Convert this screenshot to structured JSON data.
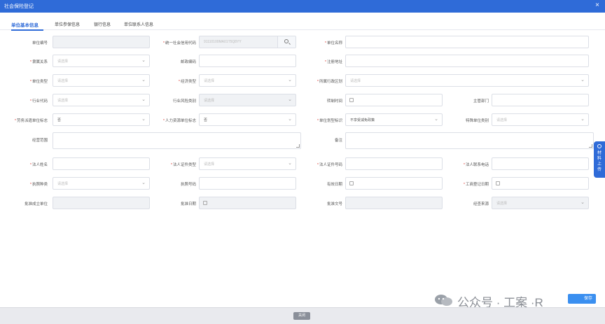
{
  "window": {
    "title": "社会保险登记",
    "close_glyph": "×"
  },
  "tabs": [
    {
      "label": "单位基本信息",
      "active": true
    },
    {
      "label": "单位参保信息",
      "active": false
    },
    {
      "label": "银行信息",
      "active": false
    },
    {
      "label": "单位联系人信息",
      "active": false
    }
  ],
  "placeholder": "请选择",
  "select_caret": "⌄",
  "fields": [
    {
      "name": "unit-number",
      "label": "单位编号",
      "required": false,
      "kind": "text",
      "disabled": true,
      "value": "",
      "placeholder": ""
    },
    {
      "name": "credit-code",
      "label": "统一社会信用代码",
      "required": true,
      "kind": "search",
      "disabled": true,
      "value": "",
      "placeholder": "91110100MA01T5Q8YY"
    },
    {
      "name": "unit-name",
      "label": "单位名称",
      "required": true,
      "kind": "text",
      "disabled": false,
      "value": "",
      "placeholder": ""
    },
    {
      "name": "affiliation",
      "label": "隶属关系",
      "required": true,
      "kind": "select",
      "disabled": false,
      "value": "",
      "placeholder": "请选择"
    },
    {
      "name": "postal-code",
      "label": "邮政编码",
      "required": false,
      "kind": "text",
      "disabled": false,
      "value": "",
      "placeholder": ""
    },
    {
      "name": "registered-address",
      "label": "注册地址",
      "required": true,
      "kind": "text",
      "disabled": false,
      "value": "",
      "placeholder": ""
    },
    {
      "name": "unit-type",
      "label": "单位类型",
      "required": true,
      "kind": "select",
      "disabled": false,
      "value": "",
      "placeholder": "请选择"
    },
    {
      "name": "economic-type",
      "label": "经济类型",
      "required": true,
      "kind": "select",
      "disabled": false,
      "value": "",
      "placeholder": "请选择"
    },
    {
      "name": "admin-region",
      "label": "所属行政区划",
      "required": true,
      "kind": "select",
      "disabled": false,
      "value": "",
      "placeholder": "请选择"
    },
    {
      "name": "industry-code",
      "label": "行业代码",
      "required": true,
      "kind": "select",
      "disabled": false,
      "value": "",
      "placeholder": "请选择"
    },
    {
      "name": "industry-risk",
      "label": "行业风险类别",
      "required": false,
      "kind": "select",
      "disabled": true,
      "value": "",
      "placeholder": "请选择"
    },
    {
      "name": "transfer-time",
      "label": "转制时间",
      "required": false,
      "kind": "date",
      "disabled": false,
      "value": "",
      "placeholder": ""
    },
    {
      "name": "supervisor-dept",
      "label": "主管部门",
      "required": false,
      "kind": "text",
      "disabled": false,
      "value": "",
      "placeholder": ""
    },
    {
      "name": "labor-dispatch",
      "label": "劳务派遣单位标志",
      "required": true,
      "kind": "select",
      "disabled": false,
      "value": "否",
      "placeholder": ""
    },
    {
      "name": "hr-unit",
      "label": "人力资源单位标志",
      "required": true,
      "kind": "select",
      "disabled": false,
      "value": "否",
      "placeholder": ""
    },
    {
      "name": "unit-scale",
      "label": "单位划型标识",
      "required": true,
      "kind": "select",
      "disabled": false,
      "value": "不享受减免政策",
      "placeholder": ""
    },
    {
      "name": "special-unit",
      "label": "特殊单位类别",
      "required": false,
      "kind": "select",
      "disabled": false,
      "value": "",
      "placeholder": "请选择"
    },
    {
      "name": "business-scope",
      "label": "经营范围",
      "required": false,
      "kind": "textarea",
      "disabled": false,
      "value": "",
      "placeholder": ""
    },
    {
      "name": "remarks",
      "label": "备注",
      "required": false,
      "kind": "textarea",
      "disabled": false,
      "value": "",
      "placeholder": ""
    },
    {
      "name": "legal-rep-name",
      "label": "法人姓名",
      "required": true,
      "kind": "text",
      "disabled": false,
      "value": "",
      "placeholder": ""
    },
    {
      "name": "legal-rep-id-type",
      "label": "法人证件类型",
      "required": true,
      "kind": "select",
      "disabled": false,
      "value": "",
      "placeholder": "请选择"
    },
    {
      "name": "legal-rep-id-number",
      "label": "法人证件号码",
      "required": true,
      "kind": "text",
      "disabled": false,
      "value": "",
      "placeholder": ""
    },
    {
      "name": "legal-rep-phone",
      "label": "法人联系电话",
      "required": true,
      "kind": "text",
      "disabled": false,
      "value": "",
      "placeholder": ""
    },
    {
      "name": "license-type",
      "label": "执照种类",
      "required": true,
      "kind": "select",
      "disabled": false,
      "value": "",
      "placeholder": "请选择"
    },
    {
      "name": "license-number",
      "label": "执照号码",
      "required": false,
      "kind": "text",
      "disabled": false,
      "value": "",
      "placeholder": ""
    },
    {
      "name": "valid-date",
      "label": "有效日期",
      "required": false,
      "kind": "date",
      "disabled": false,
      "value": "",
      "placeholder": ""
    },
    {
      "name": "business-reg-date",
      "label": "工商登记日期",
      "required": true,
      "kind": "date",
      "disabled": false,
      "value": "",
      "placeholder": ""
    },
    {
      "name": "approving-unit",
      "label": "批准成立单位",
      "required": false,
      "kind": "text",
      "disabled": true,
      "value": "",
      "placeholder": ""
    },
    {
      "name": "approval-date",
      "label": "批准日期",
      "required": false,
      "kind": "date",
      "disabled": true,
      "value": "",
      "placeholder": ""
    },
    {
      "name": "approval-doc",
      "label": "批准文号",
      "required": false,
      "kind": "text",
      "disabled": true,
      "value": "",
      "placeholder": ""
    },
    {
      "name": "data-source",
      "label": "经查来源",
      "required": false,
      "kind": "select",
      "disabled": true,
      "value": "",
      "placeholder": "请选择"
    }
  ],
  "side_tab": {
    "label": "材料上传"
  },
  "footer": {
    "close_label": "关闭"
  },
  "watermark": {
    "text": "公众号 · 工案 ·R"
  },
  "ok_button": {
    "label": "保存"
  },
  "colors": {
    "primary": "#2f6bd8",
    "required": "#e0443c"
  }
}
